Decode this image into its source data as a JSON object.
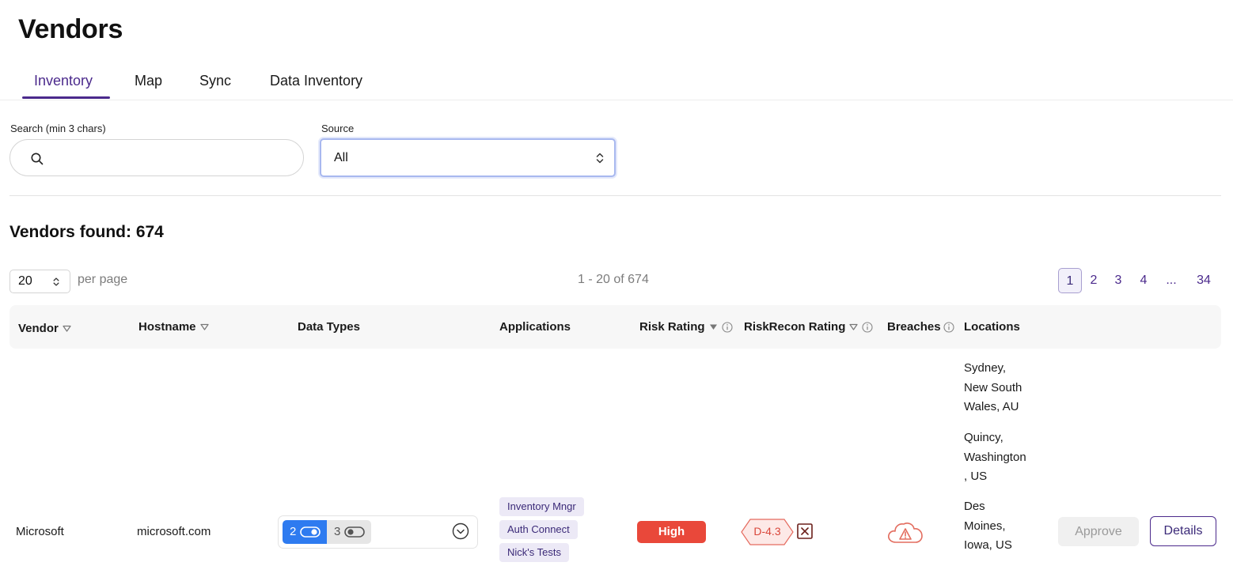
{
  "page": {
    "title": "Vendors"
  },
  "tabs": [
    {
      "label": "Inventory",
      "active": true
    },
    {
      "label": "Map",
      "active": false
    },
    {
      "label": "Sync",
      "active": false
    },
    {
      "label": "Data Inventory",
      "active": false
    }
  ],
  "filters": {
    "search": {
      "label": "Search (min 3 chars)",
      "value": "",
      "placeholder": ""
    },
    "source": {
      "label": "Source",
      "value": "All"
    }
  },
  "results": {
    "found_label": "Vendors found: 674",
    "per_page_value": "20",
    "per_page_label": "per page",
    "range_text": "1 - 20 of 674"
  },
  "pagination": {
    "pages": [
      "1",
      "2",
      "3",
      "4",
      "...",
      "34"
    ],
    "current": "1"
  },
  "table": {
    "columns": [
      {
        "label": "Vendor",
        "sortable": true
      },
      {
        "label": "Hostname",
        "sortable": true
      },
      {
        "label": "Data Types",
        "sortable": false
      },
      {
        "label": "Applications",
        "sortable": false
      },
      {
        "label": "Risk Rating",
        "sortable": true,
        "info": true
      },
      {
        "label": "RiskRecon Rating",
        "sortable": true,
        "info": true
      },
      {
        "label": "Breaches",
        "sortable": false,
        "info": true
      },
      {
        "label": "Locations",
        "sortable": false
      }
    ],
    "rows": [
      {
        "vendor": "Microsoft",
        "hostname": "microsoft.com",
        "data_types": {
          "enabled_count": "2",
          "disabled_count": "3"
        },
        "applications": [
          "Inventory Mngr",
          "Auth Connect",
          "Nick's Tests"
        ],
        "risk_rating": "High",
        "riskrecon_rating": "D-4.3",
        "breach_icon": "cloud-warning-icon",
        "locations": [
          [
            "Sydney,",
            "New South",
            "Wales, AU"
          ],
          [
            "Quincy,",
            "Washington",
            ", US"
          ],
          [
            "Des",
            "Moines,",
            "Iowa, US"
          ]
        ],
        "actions": {
          "approve": "Approve",
          "details": "Details"
        }
      }
    ]
  },
  "colors": {
    "accent": "#4b2a8c",
    "risk_high": "#e9483a",
    "toggle_blue": "#2e7bf0",
    "tag_bg": "#ece9f6"
  }
}
